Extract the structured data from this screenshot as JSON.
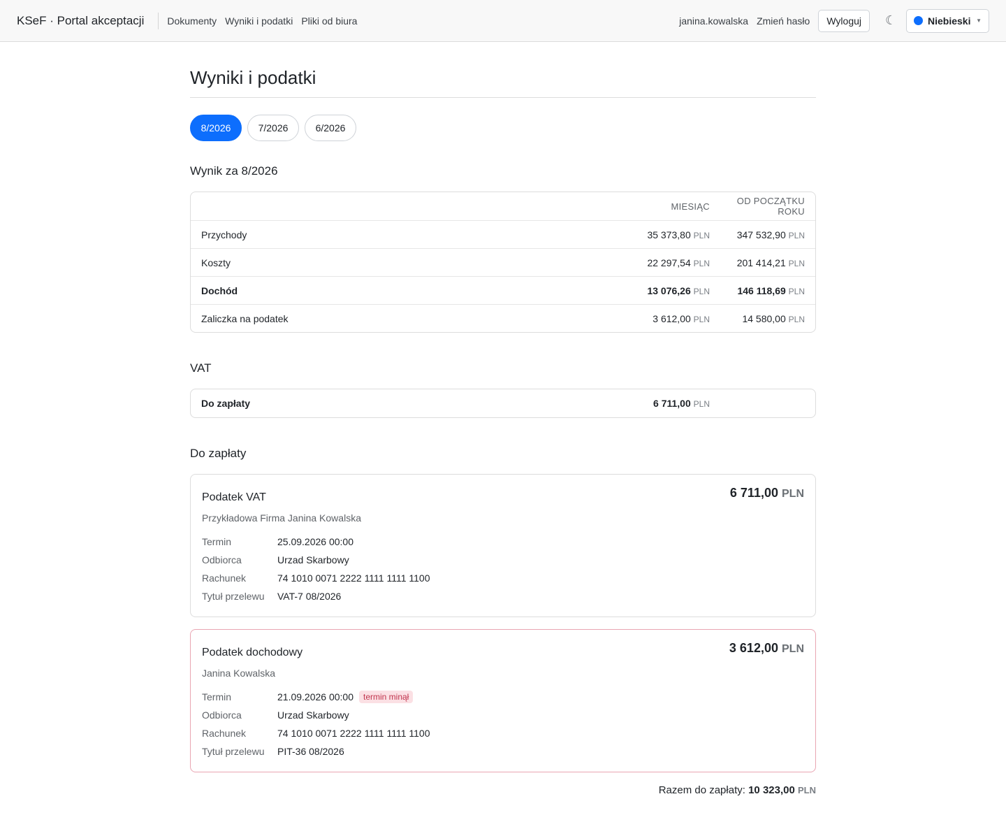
{
  "header": {
    "brand": "KSeF · Portal akceptacji",
    "nav": [
      "Dokumenty",
      "Wyniki i podatki",
      "Pliki od biura"
    ],
    "user": "janina.kowalska",
    "change_password": "Zmień hasło",
    "logout": "Wyloguj",
    "theme_icon": "☾",
    "theme_label": "Niebieski",
    "theme_color": "#0d6efd"
  },
  "page": {
    "title": "Wyniki i podatki",
    "periods": [
      "8/2026",
      "7/2026",
      "6/2026"
    ],
    "active_period": "8/2026"
  },
  "results": {
    "title": "Wynik za 8/2026",
    "col_month": "MIESIĄC",
    "col_ytd": "OD POCZĄTKU ROKU",
    "currency": "PLN",
    "rows": [
      {
        "label": "Przychody",
        "month": "35 373,80",
        "ytd": "347 532,90"
      },
      {
        "label": "Koszty",
        "month": "22 297,54",
        "ytd": "201 414,21"
      },
      {
        "label": "Dochód",
        "month": "13 076,26",
        "ytd": "146 118,69"
      },
      {
        "label": "Zaliczka na podatek",
        "month": "3 612,00",
        "ytd": "14 580,00"
      }
    ]
  },
  "vat": {
    "title": "VAT",
    "label": "Do zapłaty",
    "amount": "6 711,00",
    "currency": "PLN"
  },
  "payments": {
    "title": "Do zapłaty",
    "labels": {
      "termin": "Termin",
      "odbiorca": "Odbiorca",
      "rachunek": "Rachunek",
      "tytul": "Tytuł przelewu"
    },
    "items": [
      {
        "name": "Podatek VAT",
        "payer": "Przykładowa Firma Janina Kowalska",
        "amount": "6 711,00",
        "currency": "PLN",
        "termin": "25.09.2026 00:00",
        "odbiorca": "Urzad Skarbowy",
        "rachunek": "74 1010 0071 2222 1111 1111 1100",
        "tytul": "VAT-7 08/2026"
      },
      {
        "name": "Podatek dochodowy",
        "payer": "Janina Kowalska",
        "amount": "3 612,00",
        "currency": "PLN",
        "termin": "21.09.2026 00:00",
        "badge": "termin minął",
        "odbiorca": "Urzad Skarbowy",
        "rachunek": "74 1010 0071 2222 1111 1111 1100",
        "tytul": "PIT-36 08/2026"
      }
    ],
    "total_label": "Razem do zapłaty:",
    "total_amount": "10 323,00",
    "total_currency": "PLN"
  }
}
